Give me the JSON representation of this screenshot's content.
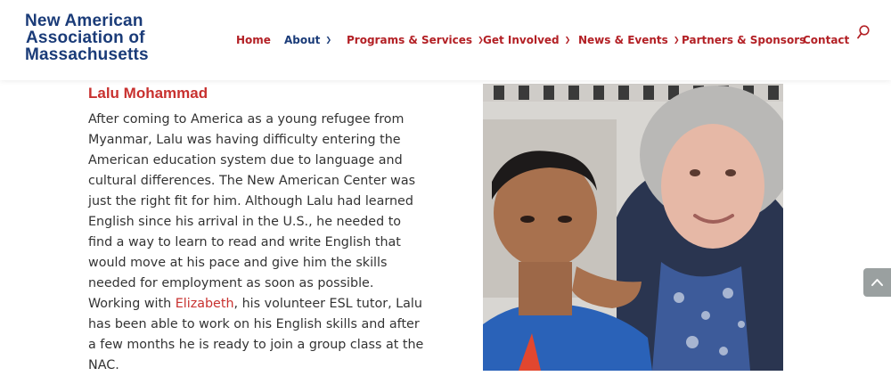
{
  "logo": {
    "line1": "New American",
    "line2": "Association of",
    "line3": "Massachusetts"
  },
  "nav": {
    "items": [
      {
        "label": "Home",
        "has_dropdown": false
      },
      {
        "label": "About",
        "has_dropdown": true,
        "active": true
      },
      {
        "label": "Programs & Services",
        "has_dropdown": true
      },
      {
        "label": "Get Involved",
        "has_dropdown": true
      },
      {
        "label": "News & Events",
        "has_dropdown": true
      },
      {
        "label": "Partners & Sponsors",
        "has_dropdown": false
      },
      {
        "label": "Contact",
        "has_dropdown": false
      }
    ],
    "dropdown_icon": "chevron-down-icon",
    "search_icon": "search-icon"
  },
  "story": {
    "name": "Lalu Mohammad",
    "text_before": "After coming to America as a young refugee from Myanmar, Lalu was having difficulty entering the American education system due to language and cultural differences. The New American Center was just the right fit for him. Although Lalu had learned English since his arrival in the U.S., he needed to find a way to learn to read and write English that would move at his pace and give him the skills needed for employment as soon as possible. Working with ",
    "link_text": "Elizabeth",
    "text_after": ", his volunteer ESL tutor, Lalu has been able to work on his English skills and after a few months he is ready to join a group class at the NAC."
  },
  "scroll_top_icon": "chevron-up-icon",
  "colors": {
    "brand_blue": "#1a3b78",
    "brand_red": "#b32025",
    "name_red": "#c8312f",
    "body_text": "#333333",
    "scroll_button": "#9aa0a0"
  }
}
